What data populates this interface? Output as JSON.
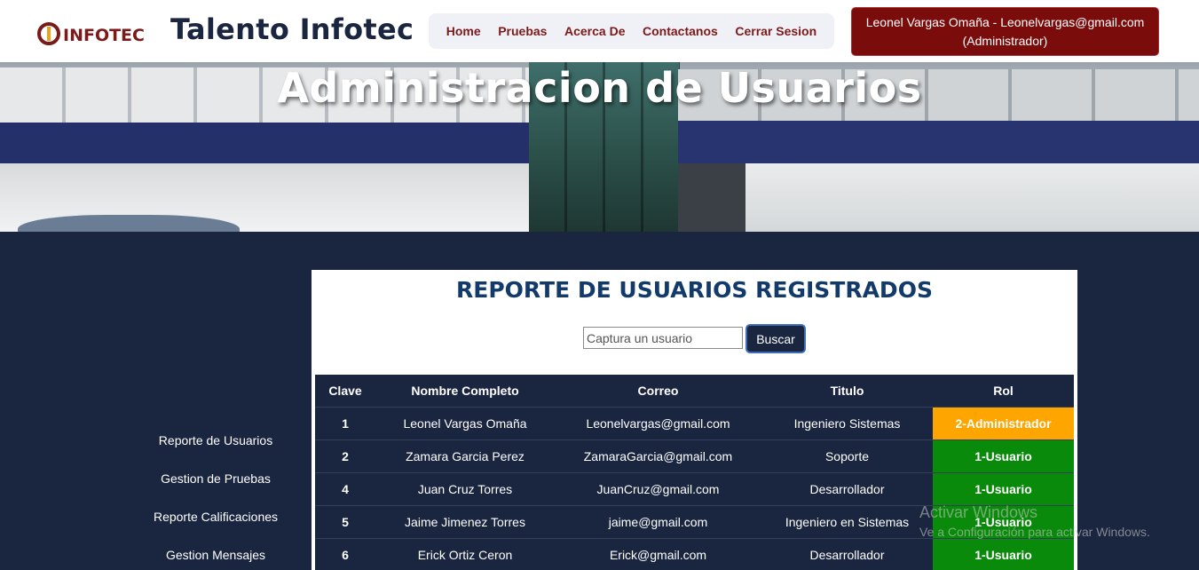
{
  "header": {
    "logo_text": "INFOTEC",
    "brand": "Talento Infotec",
    "nav": [
      "Home",
      "Pruebas",
      "Acerca De",
      "Contactanos",
      "Cerrar Sesion"
    ],
    "user_line1": "Leonel Vargas Omaña - Leonelvargas@gmail.com",
    "user_line2": "(Administrador)"
  },
  "hero": {
    "title": "Administracion de Usuarios"
  },
  "sidebar": [
    "Reporte de Usuarios",
    "Gestion de Pruebas",
    "Reporte Calificaciones",
    "Gestion Mensajes"
  ],
  "report": {
    "title": "REPORTE DE USUARIOS REGISTRADOS",
    "search_placeholder": "Captura un usuario",
    "search_button": "Buscar",
    "columns": [
      "Clave",
      "Nombre Completo",
      "Correo",
      "Titulo",
      "Rol"
    ],
    "rows": [
      [
        "1",
        "Leonel Vargas Omaña",
        "Leonelvargas@gmail.com",
        "Ingeniero Sistemas",
        "2-Administrador"
      ],
      [
        "2",
        "Zamara Garcia Perez",
        "ZamaraGarcia@gmail.com",
        "Soporte",
        "1-Usuario"
      ],
      [
        "4",
        "Juan Cruz Torres",
        "JuanCruz@gmail.com",
        "Desarrollador",
        "1-Usuario"
      ],
      [
        "5",
        "Jaime Jimenez Torres",
        "jaime@gmail.com",
        "Ingeniero en Sistemas",
        "1-Usuario"
      ],
      [
        "6",
        "Erick Ortiz Ceron",
        "Erick@gmail.com",
        "Desarrollador",
        "1-Usuario"
      ]
    ]
  },
  "watermark": {
    "line1": "Activar Windows",
    "line2": "Ve a Configuración para activar Windows."
  },
  "colors": {
    "navy": "#1a2540",
    "maroon": "#7b0c0c",
    "admin_role": "#ffa500",
    "user_role": "#0a8a0a"
  }
}
